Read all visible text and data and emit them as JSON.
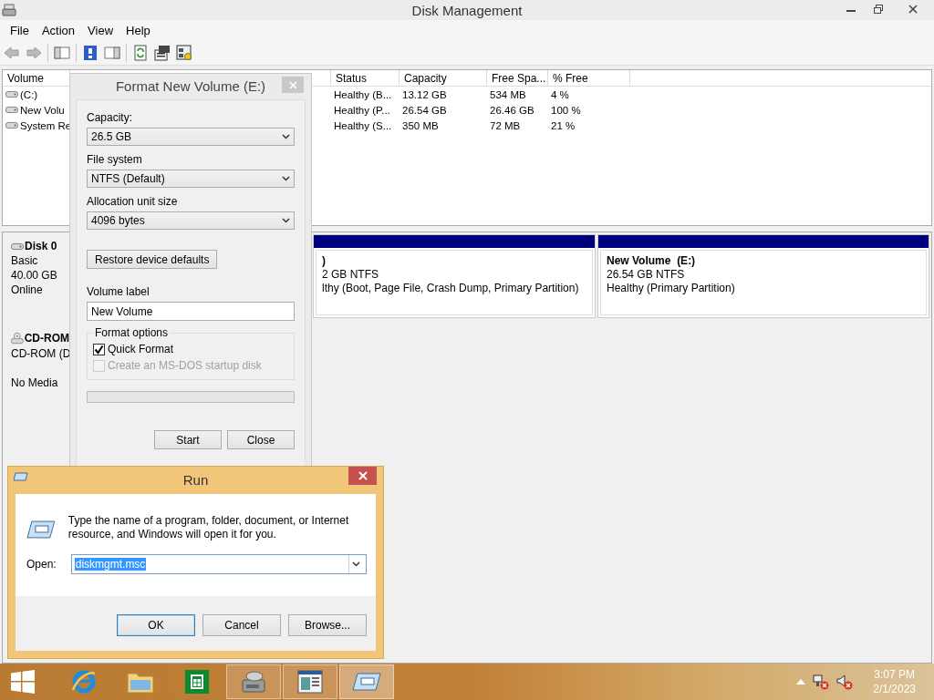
{
  "window": {
    "title": "Disk Management"
  },
  "menu": [
    "File",
    "Action",
    "View",
    "Help"
  ],
  "volume_table": {
    "columns": [
      "Volume",
      "Status",
      "Capacity",
      "Free Spa...",
      "% Free"
    ],
    "rows": [
      {
        "volume": "(C:)",
        "status": "Healthy (B...",
        "capacity": "13.12 GB",
        "free_space": "534 MB",
        "percent_free": "4 %"
      },
      {
        "volume": "New Volu",
        "status": "Healthy (P...",
        "capacity": "26.54 GB",
        "free_space": "26.46 GB",
        "percent_free": "100 %"
      },
      {
        "volume": "System Re",
        "status": "Healthy (S...",
        "capacity": "350 MB",
        "free_space": "72 MB",
        "percent_free": "21 %"
      }
    ]
  },
  "disks": [
    {
      "kind": "disk",
      "name": "Disk 0",
      "type": "Basic",
      "size": "40.00 GB",
      "status": "Online",
      "partitions": [
        {
          "title": ")",
          "size": "2 GB NTFS",
          "status": "lthy (Boot, Page File, Crash Dump, Primary Partition)"
        },
        {
          "title": "New Volume  (E:)",
          "size": "26.54 GB NTFS",
          "status": "Healthy (Primary Partition)"
        }
      ]
    },
    {
      "kind": "cdrom",
      "name": "CD-ROM",
      "type": "CD-ROM (D",
      "status": "No Media"
    }
  ],
  "format_dialog": {
    "title": "Format New Volume (E:)",
    "selects": [
      {
        "label": "Capacity:",
        "value": "26.5 GB"
      },
      {
        "label": "File system",
        "value": "NTFS (Default)"
      },
      {
        "label": "Allocation unit size",
        "value": "4096 bytes"
      }
    ],
    "restore_button": "Restore device defaults",
    "volume_label": {
      "label": "Volume label",
      "value": "New Volume"
    },
    "options": {
      "title": "Format options",
      "items": [
        {
          "label": "Quick Format",
          "checked": true,
          "disabled": false
        },
        {
          "label": "Create an MS-DOS startup disk",
          "checked": false,
          "disabled": true
        }
      ]
    },
    "progress": {
      "level": 0
    },
    "buttons": [
      "Start",
      "Close"
    ]
  },
  "run_dialog": {
    "title": "Run",
    "message": "Type the name of a program, folder, document, or Internet resource, and Windows will open it for you.",
    "open_label": "Open:",
    "value": "diskmgmt.msc",
    "value_selected": true,
    "buttons": [
      {
        "label": "OK",
        "default": true
      },
      {
        "label": "Cancel",
        "default": false
      },
      {
        "label": "Browse...",
        "default": false
      }
    ]
  },
  "taskbar": {
    "apps": [
      {
        "kind": "ie",
        "running": false,
        "selected": false
      },
      {
        "kind": "explorer",
        "running": false,
        "selected": false
      },
      {
        "kind": "store",
        "running": false,
        "selected": false
      },
      {
        "kind": "disk",
        "running": true,
        "selected": false
      },
      {
        "kind": "document",
        "running": true,
        "selected": false
      },
      {
        "kind": "run",
        "running": true,
        "selected": true
      }
    ],
    "clock": {
      "time": "3:07 PM",
      "date": "2/1/2023"
    }
  }
}
